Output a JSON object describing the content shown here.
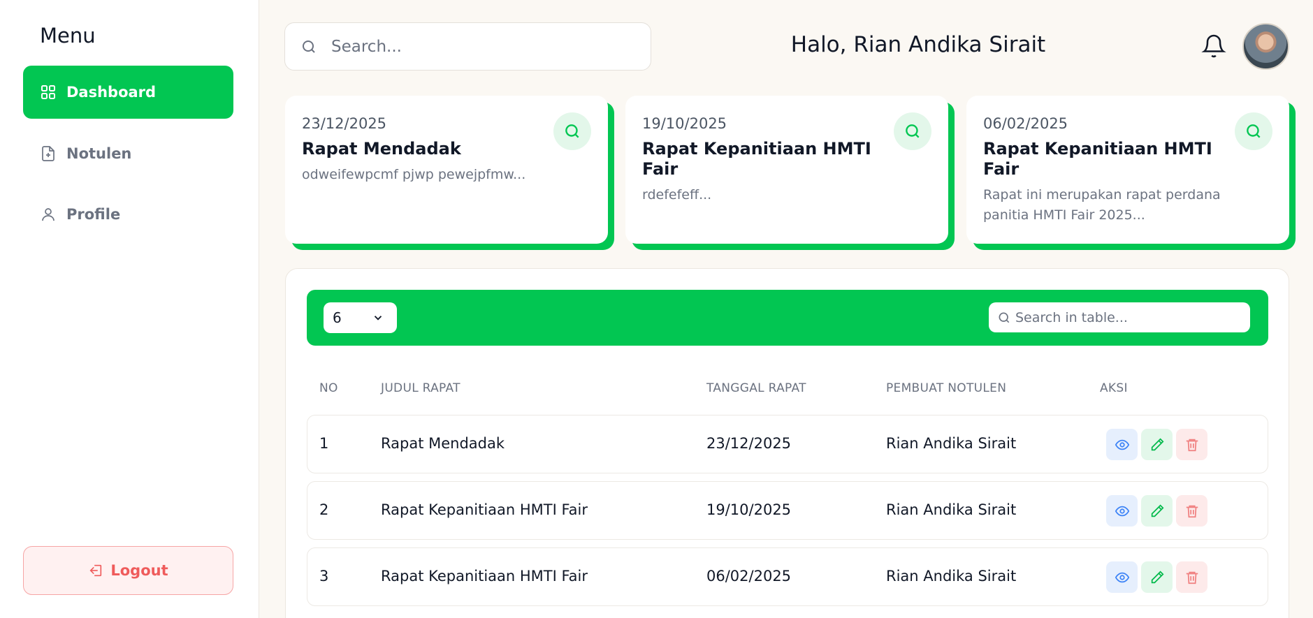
{
  "sidebar": {
    "menu_title": "Menu",
    "items": [
      {
        "label": "Dashboard",
        "icon": "grid-icon",
        "active": true
      },
      {
        "label": "Notulen",
        "icon": "file-plus-icon",
        "active": false
      },
      {
        "label": "Profile",
        "icon": "user-icon",
        "active": false
      }
    ],
    "logout_label": "Logout"
  },
  "header": {
    "search_placeholder": "Search...",
    "greeting": "Halo, Rian Andika Sirait"
  },
  "cards": [
    {
      "date": "23/12/2025",
      "title": "Rapat Mendadak",
      "desc": "odweifewpcmf pjwp pewejpfmw..."
    },
    {
      "date": "19/10/2025",
      "title": "Rapat Kepanitiaan HMTI Fair",
      "desc": "rdefefeff..."
    },
    {
      "date": "06/02/2025",
      "title": "Rapat Kepanitiaan HMTI Fair",
      "desc": "Rapat ini merupakan rapat perdana panitia HMTI Fair 2025..."
    }
  ],
  "table": {
    "page_size": "6",
    "search_placeholder": "Search in table...",
    "columns": [
      "NO",
      "JUDUL RAPAT",
      "TANGGAL RAPAT",
      "PEMBUAT NOTULEN",
      "AKSI"
    ],
    "rows": [
      {
        "no": "1",
        "judul": "Rapat Mendadak",
        "tanggal": "23/12/2025",
        "pembuat": "Rian Andika Sirait"
      },
      {
        "no": "2",
        "judul": "Rapat Kepanitiaan HMTI Fair",
        "tanggal": "19/10/2025",
        "pembuat": "Rian Andika Sirait"
      },
      {
        "no": "3",
        "judul": "Rapat Kepanitiaan HMTI Fair",
        "tanggal": "06/02/2025",
        "pembuat": "Rian Andika Sirait"
      }
    ]
  },
  "colors": {
    "accent": "#02c652",
    "logout": "#ef5b5b",
    "view": "#3b82f6",
    "delete": "#f08080"
  }
}
